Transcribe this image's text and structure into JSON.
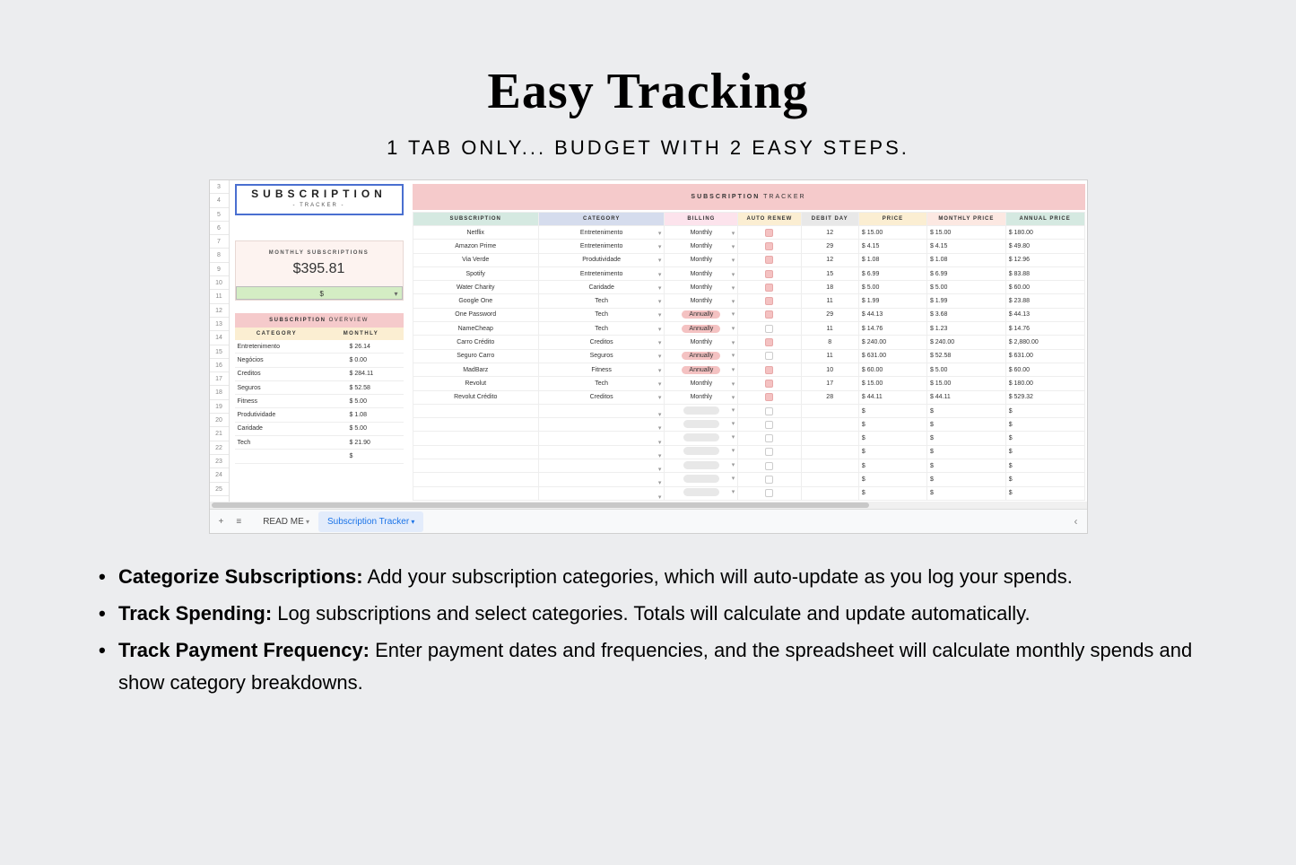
{
  "title": "Easy Tracking",
  "subtitle": "1 TAB ONLY... BUDGET WITH 2 EASY STEPS.",
  "rowNums": [
    "3",
    "4",
    "5",
    "6",
    "7",
    "8",
    "9",
    "10",
    "11",
    "12",
    "13",
    "14",
    "15",
    "16",
    "17",
    "18",
    "19",
    "20",
    "21",
    "22",
    "23",
    "24",
    "25"
  ],
  "subBox": {
    "title": "SUBSCRIPTION",
    "sub": "- TRACKER -"
  },
  "monthlySub": {
    "label": "MONTHLY SUBSCRIPTIONS",
    "value": "$395.81",
    "dd": "$"
  },
  "overview": {
    "title1": "SUBSCRIPTION",
    "title2": " OVERVIEW",
    "cols": [
      "CATEGORY",
      "MONTHLY"
    ],
    "rows": [
      {
        "c": "Entretenimento",
        "v": "$   26.14"
      },
      {
        "c": "Negócios",
        "v": "$   0.00"
      },
      {
        "c": "Creditos",
        "v": "$   284.11"
      },
      {
        "c": "Seguros",
        "v": "$   52.58"
      },
      {
        "c": "Fitness",
        "v": "$   5.00"
      },
      {
        "c": "Produtividade",
        "v": "$   1.08"
      },
      {
        "c": "Caridade",
        "v": "$   5.00"
      },
      {
        "c": "Tech",
        "v": "$   21.90"
      },
      {
        "c": "",
        "v": "$"
      }
    ]
  },
  "tracker": {
    "title1": "SUBSCRIPTION",
    "title2": " TRACKER",
    "headers": [
      "SUBSCRIPTION",
      "CATEGORY",
      "BILLING",
      "AUTO RENEW",
      "DEBIT DAY",
      "PRICE",
      "MONTHLY PRICE",
      "ANNUAL PRICE"
    ],
    "rows": [
      {
        "s": "Netflix",
        "c": "Entretenimento",
        "b": "Monthly",
        "a": true,
        "d": "12",
        "p": "$   15.00",
        "m": "$   15.00",
        "y": "$   180.00"
      },
      {
        "s": "Amazon Prime",
        "c": "Entretenimento",
        "b": "Monthly",
        "a": true,
        "d": "29",
        "p": "$   4.15",
        "m": "$   4.15",
        "y": "$   49.80"
      },
      {
        "s": "Via Verde",
        "c": "Produtividade",
        "b": "Monthly",
        "a": true,
        "d": "12",
        "p": "$   1.08",
        "m": "$   1.08",
        "y": "$   12.96"
      },
      {
        "s": "Spotify",
        "c": "Entretenimento",
        "b": "Monthly",
        "a": true,
        "d": "15",
        "p": "$   6.99",
        "m": "$   6.99",
        "y": "$   83.88"
      },
      {
        "s": "Water Charity",
        "c": "Caridade",
        "b": "Monthly",
        "a": true,
        "d": "18",
        "p": "$   5.00",
        "m": "$   5.00",
        "y": "$   60.00"
      },
      {
        "s": "Google One",
        "c": "Tech",
        "b": "Monthly",
        "a": true,
        "d": "11",
        "p": "$   1.99",
        "m": "$   1.99",
        "y": "$   23.88"
      },
      {
        "s": "One Password",
        "c": "Tech",
        "b": "Annually",
        "a": true,
        "d": "29",
        "p": "$   44.13",
        "m": "$   3.68",
        "y": "$   44.13",
        "pill": true
      },
      {
        "s": "NameCheap",
        "c": "Tech",
        "b": "Annually",
        "a": false,
        "d": "11",
        "p": "$   14.76",
        "m": "$   1.23",
        "y": "$   14.76",
        "pill": true
      },
      {
        "s": "Carro Crédito",
        "c": "Creditos",
        "b": "Monthly",
        "a": true,
        "d": "8",
        "p": "$   240.00",
        "m": "$   240.00",
        "y": "$   2,880.00"
      },
      {
        "s": "Seguro Carro",
        "c": "Seguros",
        "b": "Annually",
        "a": false,
        "d": "11",
        "p": "$   631.00",
        "m": "$   52.58",
        "y": "$   631.00",
        "pill": true
      },
      {
        "s": "MadBarz",
        "c": "Fitness",
        "b": "Annually",
        "a": true,
        "d": "10",
        "p": "$   60.00",
        "m": "$   5.00",
        "y": "$   60.00",
        "pill": true
      },
      {
        "s": "Revolut",
        "c": "Tech",
        "b": "Monthly",
        "a": true,
        "d": "17",
        "p": "$   15.00",
        "m": "$   15.00",
        "y": "$   180.00"
      },
      {
        "s": "Revolut Crédito",
        "c": "Creditos",
        "b": "Monthly",
        "a": true,
        "d": "28",
        "p": "$   44.11",
        "m": "$   44.11",
        "y": "$   529.32"
      }
    ],
    "emptyRows": 7
  },
  "tabs": {
    "read": "READ ME",
    "active": "Subscription Tracker"
  },
  "bullets": [
    {
      "b": "Categorize Subscriptions:",
      "t": " Add your subscription categories, which will auto-update as you log your spends."
    },
    {
      "b": "Track Spending:",
      "t": " Log subscriptions and select categories. Totals will calculate and update automatically."
    },
    {
      "b": "Track Payment Frequency:",
      "t": " Enter payment dates and frequencies, and the spreadsheet will calculate monthly spends and show category breakdowns."
    }
  ]
}
